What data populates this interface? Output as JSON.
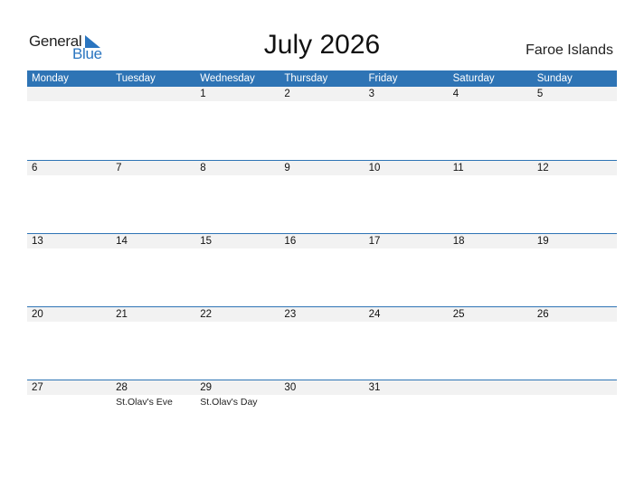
{
  "logo": {
    "general": "General",
    "blue": "Blue"
  },
  "title": "July 2026",
  "country": "Faroe Islands",
  "colors": {
    "accent": "#2e74b5",
    "band": "#f2f2f2"
  },
  "weekdays": [
    "Monday",
    "Tuesday",
    "Wednesday",
    "Thursday",
    "Friday",
    "Saturday",
    "Sunday"
  ],
  "weeks": [
    [
      {
        "d": ""
      },
      {
        "d": ""
      },
      {
        "d": "1"
      },
      {
        "d": "2"
      },
      {
        "d": "3"
      },
      {
        "d": "4"
      },
      {
        "d": "5"
      }
    ],
    [
      {
        "d": "6"
      },
      {
        "d": "7"
      },
      {
        "d": "8"
      },
      {
        "d": "9"
      },
      {
        "d": "10"
      },
      {
        "d": "11"
      },
      {
        "d": "12"
      }
    ],
    [
      {
        "d": "13"
      },
      {
        "d": "14"
      },
      {
        "d": "15"
      },
      {
        "d": "16"
      },
      {
        "d": "17"
      },
      {
        "d": "18"
      },
      {
        "d": "19"
      }
    ],
    [
      {
        "d": "20"
      },
      {
        "d": "21"
      },
      {
        "d": "22"
      },
      {
        "d": "23"
      },
      {
        "d": "24"
      },
      {
        "d": "25"
      },
      {
        "d": "26"
      }
    ],
    [
      {
        "d": "27"
      },
      {
        "d": "28",
        "e": "St.Olav's Eve"
      },
      {
        "d": "29",
        "e": "St.Olav's Day"
      },
      {
        "d": "30"
      },
      {
        "d": "31"
      },
      {
        "d": ""
      },
      {
        "d": ""
      }
    ]
  ]
}
